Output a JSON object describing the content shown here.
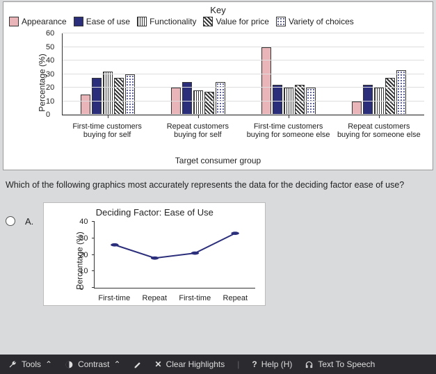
{
  "chart_data": [
    {
      "type": "bar",
      "title": "Key",
      "ylabel": "Percentage (%)",
      "xlabel": "Target consumer group",
      "ylim": [
        0,
        60
      ],
      "yticks": [
        0,
        10,
        20,
        30,
        40,
        50,
        60
      ],
      "categories": [
        "First-time customers buying for self",
        "Repeat customers buying for self",
        "First-time customers buying for someone else",
        "Repeat customers buying for someone else"
      ],
      "series": [
        {
          "name": "Appearance",
          "values": [
            15,
            20,
            50,
            10
          ]
        },
        {
          "name": "Ease of use",
          "values": [
            27,
            24,
            22,
            22
          ]
        },
        {
          "name": "Functionality",
          "values": [
            32,
            18,
            20,
            20
          ]
        },
        {
          "name": "Value for price",
          "values": [
            27,
            17,
            22,
            27
          ]
        },
        {
          "name": "Variety of choices",
          "values": [
            30,
            24,
            20,
            33
          ]
        }
      ]
    },
    {
      "type": "line",
      "title": "Deciding Factor: Ease of Use",
      "ylabel": "Percentage (%)",
      "ylim": [
        0,
        40
      ],
      "yticks": [
        0,
        10,
        20,
        30,
        40
      ],
      "categories": [
        "First-time",
        "Repeat",
        "First-time",
        "Repeat"
      ],
      "values": [
        26,
        18,
        21,
        33
      ]
    }
  ],
  "legend": {
    "title": "Key",
    "items": [
      "Appearance",
      "Ease of use",
      "Functionality",
      "Value for price",
      "Variety of choices"
    ]
  },
  "question": "Which of the following graphics most accurately represents the data for the deciding factor ease of use?",
  "option_letter": "A.",
  "toolbar": {
    "tools": "Tools",
    "contrast": "Contrast",
    "clear": "Clear Highlights",
    "help": "Help (H)",
    "tts": "Text To Speech"
  }
}
